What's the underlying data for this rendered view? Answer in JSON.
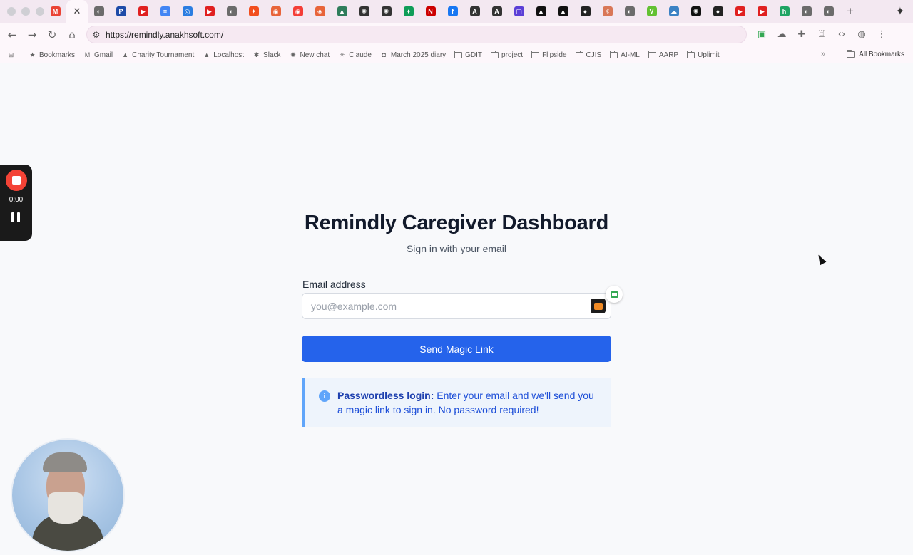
{
  "browser": {
    "tabs": [
      {
        "name": "gmail",
        "color": "#ea4335",
        "glyph": "M"
      },
      {
        "name": "remindly",
        "active": true
      },
      {
        "name": "globe",
        "color": "#6b6b6b",
        "glyph": "◐"
      },
      {
        "name": "paypal",
        "color": "#1e4ba8",
        "glyph": "P"
      },
      {
        "name": "youtube",
        "color": "#e02020",
        "glyph": "▶"
      },
      {
        "name": "google-docs",
        "color": "#4285f4",
        "glyph": "≡"
      },
      {
        "name": "chrome",
        "color": "#2a7de1",
        "glyph": "◎"
      },
      {
        "name": "youtube",
        "color": "#e02020",
        "glyph": "▶"
      },
      {
        "name": "globe",
        "color": "#6b6b6b",
        "glyph": "◐"
      },
      {
        "name": "figma",
        "color": "#f24e1e",
        "glyph": "✦"
      },
      {
        "name": "coin",
        "color": "#e8643a",
        "glyph": "◉"
      },
      {
        "name": "pocketcasts",
        "color": "#f43e37",
        "glyph": "◉"
      },
      {
        "name": "mesh",
        "color": "#e8643a",
        "glyph": "◈"
      },
      {
        "name": "arrow",
        "color": "#2e7d5b",
        "glyph": "▲"
      },
      {
        "name": "openai",
        "color": "#333",
        "glyph": "✺"
      },
      {
        "name": "openai",
        "color": "#333",
        "glyph": "✺"
      },
      {
        "name": "sheets",
        "color": "#0f9d58",
        "glyph": "+"
      },
      {
        "name": "cnn",
        "color": "#cc0000",
        "glyph": "N"
      },
      {
        "name": "facebook",
        "color": "#1877f2",
        "glyph": "f"
      },
      {
        "name": "circle-a",
        "color": "#333",
        "glyph": "A"
      },
      {
        "name": "circle-a",
        "color": "#333",
        "glyph": "A"
      },
      {
        "name": "purple-square",
        "color": "#5b3fd6",
        "glyph": "▢"
      },
      {
        "name": "triangle",
        "color": "#111",
        "glyph": "▲"
      },
      {
        "name": "triangle",
        "color": "#111",
        "glyph": "▲"
      },
      {
        "name": "github",
        "color": "#222",
        "glyph": "●"
      },
      {
        "name": "claude",
        "color": "#d97757",
        "glyph": "✳"
      },
      {
        "name": "globe",
        "color": "#6b6b6b",
        "glyph": "◐"
      },
      {
        "name": "leaf",
        "color": "#63c132",
        "glyph": "V"
      },
      {
        "name": "cloud-app",
        "color": "#3b82c4",
        "glyph": "☁"
      },
      {
        "name": "openai-black",
        "color": "#111",
        "glyph": "✺"
      },
      {
        "name": "github",
        "color": "#222",
        "glyph": "●"
      },
      {
        "name": "youtube",
        "color": "#e02020",
        "glyph": "▶"
      },
      {
        "name": "youtube",
        "color": "#e02020",
        "glyph": "▶"
      },
      {
        "name": "h-app",
        "color": "#1fa463",
        "glyph": "h"
      },
      {
        "name": "globe",
        "color": "#6b6b6b",
        "glyph": "◐"
      },
      {
        "name": "globe",
        "color": "#6b6b6b",
        "glyph": "◐"
      }
    ],
    "new_tab_label": "+",
    "url": "https://remindly.anakhsoft.com/",
    "bookmarks": [
      {
        "label": "Bookmarks",
        "icon": "star"
      },
      {
        "label": "Gmail",
        "icon": "gmail"
      },
      {
        "label": "Charity Tournament",
        "icon": "triangle"
      },
      {
        "label": "Localhost",
        "icon": "triangle"
      },
      {
        "label": "Slack",
        "icon": "slack"
      },
      {
        "label": "New chat",
        "icon": "openai"
      },
      {
        "label": "Claude",
        "icon": "claude"
      },
      {
        "label": "March 2025 diary",
        "icon": "diary"
      },
      {
        "label": "GDIT",
        "icon": "folder"
      },
      {
        "label": "project",
        "icon": "folder"
      },
      {
        "label": "Flipside",
        "icon": "folder"
      },
      {
        "label": "CJIS",
        "icon": "folder"
      },
      {
        "label": "AI-ML",
        "icon": "folder"
      },
      {
        "label": "AARP",
        "icon": "folder"
      },
      {
        "label": "Uplimit",
        "icon": "folder"
      }
    ],
    "all_bookmarks_label": "All Bookmarks"
  },
  "page": {
    "title": "Remindly Caregiver Dashboard",
    "subtitle": "Sign in with your email",
    "email_label": "Email address",
    "email_placeholder": "you@example.com",
    "email_value": "",
    "submit_label": "Send Magic Link",
    "info_bold": "Passwordless login:",
    "info_text": " Enter your email and we'll send you a magic link to sign in. No password required!",
    "accent_color": "#2563eb"
  },
  "recorder": {
    "time": "0:00"
  }
}
